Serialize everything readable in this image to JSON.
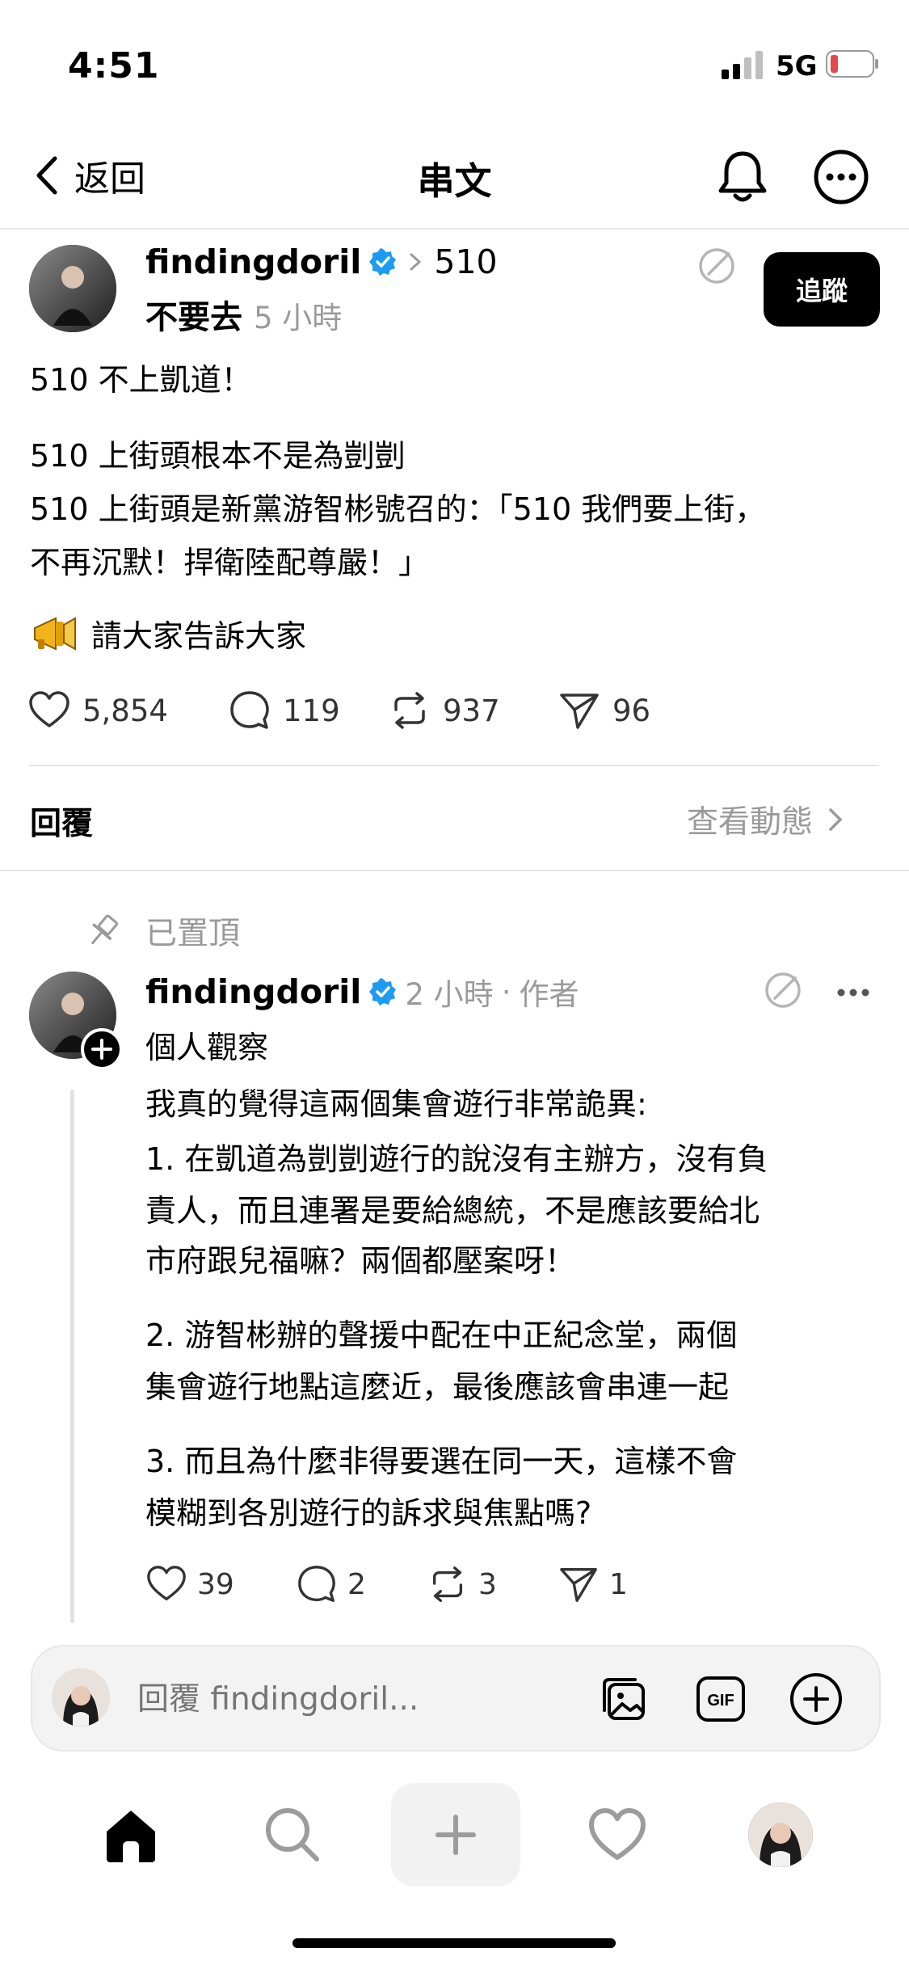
{
  "status_bar": {
    "time": "4:51",
    "network": "5G",
    "battery_color": "#e5484d"
  },
  "header": {
    "back_label": "返回",
    "title": "串文"
  },
  "post": {
    "username": "findingdoril",
    "topic": "510",
    "subtitle": "不要去",
    "time_ago": "5 小時",
    "follow_label": "追蹤",
    "lines": [
      "510 不上凱道！",
      "510 上街頭根本不是為剴剴",
      "510 上街頭是新黨游智彬號召的：「510 我們要上街，",
      "不再沉默！捍衛陸配尊嚴！」"
    ],
    "announcement": "請大家告訴大家",
    "stats": {
      "likes": "5,854",
      "comments": "119",
      "reposts": "937",
      "shares": "96"
    }
  },
  "replies_section": {
    "label": "回覆",
    "activity_label": "查看動態"
  },
  "pinned_reply": {
    "pinned_label": "已置頂",
    "username": "findingdoril",
    "time_ago": "2 小時",
    "author_tag": "作者",
    "lines": [
      "個人觀察",
      "我真的覺得這兩個集會遊行非常詭異:",
      "1.  在凱道為剴剴遊行的說沒有主辦方，沒有負",
      "責人，而且連署是要給總統，不是應該要給北",
      "市府跟兒福嘛？兩個都壓案呀！",
      "2.  游智彬辦的聲援中配在中正紀念堂，兩個",
      "集會遊行地點這麼近，最後應該會串連一起",
      "3.  而且為什麼非得要選在同一天，這樣不會",
      "模糊到各別遊行的訴求與焦點嗎?"
    ],
    "stats": {
      "likes": "39",
      "comments": "2",
      "reposts": "3",
      "shares": "1"
    }
  },
  "reply_input": {
    "placeholder": "回覆 findingdoril..."
  },
  "accent_color": "#1d9bf0"
}
